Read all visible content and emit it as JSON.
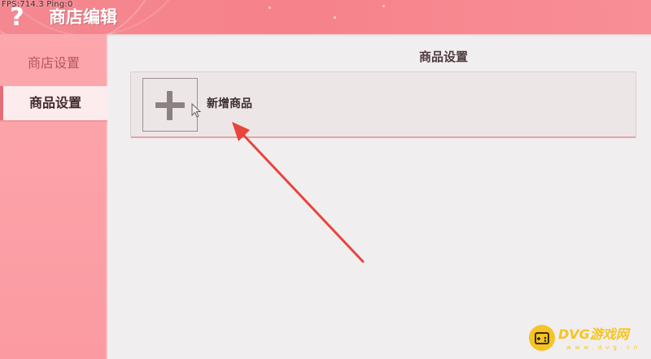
{
  "overlay": {
    "fps_text": "FPS:714.3  Ping:0"
  },
  "window": {
    "title": "商店编辑",
    "help_glyph": "?"
  },
  "sidebar": {
    "items": [
      {
        "label": "商店设置",
        "selected": false
      },
      {
        "label": "商品设置",
        "selected": true
      }
    ]
  },
  "main": {
    "section_title": "商品设置",
    "add_product": {
      "label": "新增商品",
      "icon": "plus-icon"
    }
  },
  "annotation": {
    "color": "#e8453c"
  },
  "watermark": {
    "text": "DVG游戏网",
    "sub": "www.dvg.cn"
  },
  "colors": {
    "title_bar": "#f6828b",
    "sidebar": "#fca7ad",
    "sidebar_selected": "#fdeced",
    "accent": "#e46e77",
    "watermark": "#f6c51f"
  }
}
